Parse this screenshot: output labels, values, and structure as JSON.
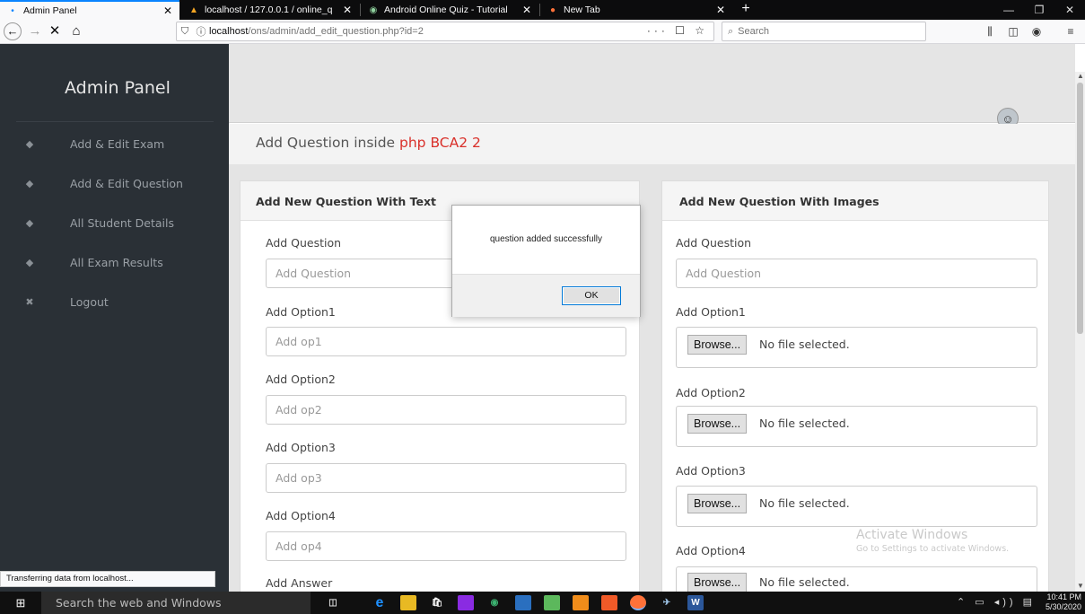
{
  "browser": {
    "tabs": [
      {
        "label": "Admin Panel",
        "icon": "dot-icon",
        "active": true
      },
      {
        "label": "localhost / 127.0.0.1 / online_q",
        "icon": "phpmyadmin-icon",
        "active": false
      },
      {
        "label": "Android Online Quiz - Tutorial",
        "icon": "globe-icon",
        "active": false
      },
      {
        "label": "New Tab",
        "icon": "firefox-icon",
        "active": false
      }
    ],
    "close_glyph": "✕",
    "new_tab_glyph": "+",
    "url": {
      "host": "localhost",
      "path": "/ons/admin/add_edit_question.php?id=2"
    },
    "url_actions": "··· ☐ ☆",
    "search_placeholder": "Search"
  },
  "sidebar": {
    "brand": "Admin Panel",
    "items": [
      {
        "label": "Add & Edit Exam",
        "icon": "dashboard-icon"
      },
      {
        "label": "Add & Edit Question",
        "icon": "dashboard-icon"
      },
      {
        "label": "All Student Details",
        "icon": "dashboard-icon"
      },
      {
        "label": "All Exam Results",
        "icon": "dashboard-icon"
      },
      {
        "label": "Logout",
        "icon": "close-icon"
      }
    ]
  },
  "header": {
    "title_prefix": "Add Question inside ",
    "title_accent": "php BCA2 2"
  },
  "text_panel": {
    "title": "Add New Question With Text",
    "fields": [
      {
        "label": "Add Question",
        "placeholder": "Add Question"
      },
      {
        "label": "Add Option1",
        "placeholder": "Add op1"
      },
      {
        "label": "Add Option2",
        "placeholder": "Add op2"
      },
      {
        "label": "Add Option3",
        "placeholder": "Add op3"
      },
      {
        "label": "Add Option4",
        "placeholder": "Add op4"
      },
      {
        "label": "Add Answer"
      }
    ]
  },
  "image_panel": {
    "title": "Add New Question With Images",
    "question_label": "Add Question",
    "question_placeholder": "Add Question",
    "file_fields": [
      {
        "label": "Add Option1",
        "button": "Browse...",
        "status": "No file selected."
      },
      {
        "label": "Add Option2",
        "button": "Browse...",
        "status": "No file selected."
      },
      {
        "label": "Add Option3",
        "button": "Browse...",
        "status": "No file selected."
      },
      {
        "label": "Add Option4",
        "button": "Browse...",
        "status": "No file selected."
      }
    ]
  },
  "dialog": {
    "message": "question added successfully",
    "ok_label": "OK"
  },
  "status_bar": "Transferring data from localhost...",
  "watermark": {
    "title": "Activate Windows",
    "subtitle": "Go to Settings to activate Windows."
  },
  "taskbar": {
    "search_placeholder": "Search the web and Windows",
    "time": "10:41 PM",
    "date": "5/30/2020"
  },
  "colors": {
    "sidebar_bg": "#2a3036",
    "accent_red": "#d9302a",
    "tab_active_border": "#0a84ff"
  }
}
